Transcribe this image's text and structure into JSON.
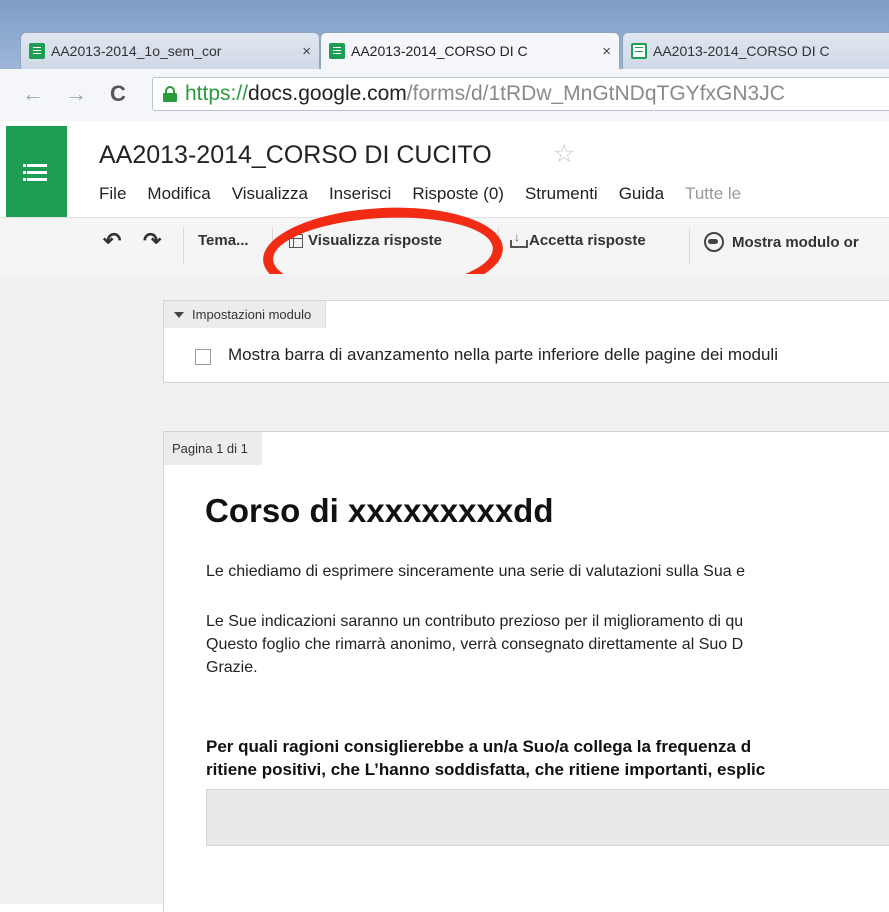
{
  "browser": {
    "tabs": [
      {
        "title": "AA2013-2014_1o_sem_cor",
        "icon": "forms-icon",
        "active": false
      },
      {
        "title": "AA2013-2014_CORSO DI C",
        "icon": "forms-icon",
        "active": true
      },
      {
        "title": "AA2013-2014_CORSO DI C",
        "icon": "sheets-icon",
        "active": false
      }
    ],
    "close_glyph": "×",
    "back_glyph": "←",
    "forward_glyph": "→",
    "reload_glyph": "C",
    "url_scheme": "https://",
    "url_host": "docs.google.com",
    "url_path": "/forms/d/1tRDw_MnGtNDqTGYfxGN3JC"
  },
  "doc": {
    "title": "AA2013-2014_CORSO DI CUCITO",
    "star": "☆",
    "menu": [
      "File",
      "Modifica",
      "Visualizza",
      "Inserisci",
      "Risposte (0)",
      "Strumenti",
      "Guida"
    ],
    "menu_muted": "Tutte le"
  },
  "toolbar": {
    "undo": "↶",
    "redo": "↷",
    "theme": "Tema...",
    "view_responses": "Visualizza risposte",
    "accept_responses": "Accetta risposte",
    "show_form": "Mostra modulo or"
  },
  "settings": {
    "tab_label": "Impostazioni modulo",
    "progress_checkbox_label": "Mostra barra di avanzamento nella parte inferiore delle pagine dei moduli"
  },
  "page": {
    "tab_label": "Pagina 1 di 1",
    "form_title": "Corso di xxxxxxxxxdd",
    "description": [
      "Le chiediamo di esprimere sinceramente una serie di valutazioni sulla Sua e",
      "Le Sue indicazioni saranno un contributo prezioso per il miglioramento di qu",
      "Questo foglio che rimarrà anonimo, verrà consegnato direttamente al Suo D",
      "Grazie."
    ],
    "question": [
      "Per quali ragioni consiglierebbe a un/a Suo/a collega la frequenza d",
      "ritiene positivi, che L’hanno soddisfatta, che ritiene importanti, esplic"
    ]
  }
}
